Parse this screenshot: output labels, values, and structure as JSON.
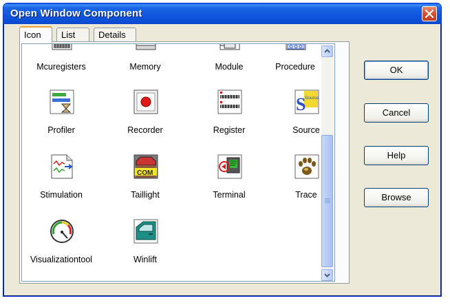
{
  "window": {
    "title": "Open Window Component"
  },
  "tabs": [
    {
      "label": "Icon",
      "active": true
    },
    {
      "label": "List",
      "active": false
    },
    {
      "label": "Details",
      "active": false
    }
  ],
  "items": [
    {
      "label": "Mcuregisters",
      "icon": "mcuregisters-icon"
    },
    {
      "label": "Memory",
      "icon": "memory-icon"
    },
    {
      "label": "Module",
      "icon": "module-icon"
    },
    {
      "label": "Procedure",
      "icon": "procedure-icon"
    },
    {
      "label": "Profiler",
      "icon": "profiler-icon"
    },
    {
      "label": "Recorder",
      "icon": "recorder-icon"
    },
    {
      "label": "Register",
      "icon": "register-icon"
    },
    {
      "label": "Source",
      "icon": "source-icon"
    },
    {
      "label": "Stimulation",
      "icon": "stimulation-icon"
    },
    {
      "label": "Taillight",
      "icon": "taillight-icon"
    },
    {
      "label": "Terminal",
      "icon": "terminal-icon"
    },
    {
      "label": "Trace",
      "icon": "trace-icon"
    },
    {
      "label": "Visualizationtool",
      "icon": "visualizationtool-icon"
    },
    {
      "label": "Winlift",
      "icon": "winlift-icon"
    }
  ],
  "buttons": {
    "ok": "OK",
    "cancel": "Cancel",
    "help": "Help",
    "browse": "Browse"
  },
  "icon_glyphs": {
    "source_text": "Source",
    "taillight_text": "COM"
  }
}
